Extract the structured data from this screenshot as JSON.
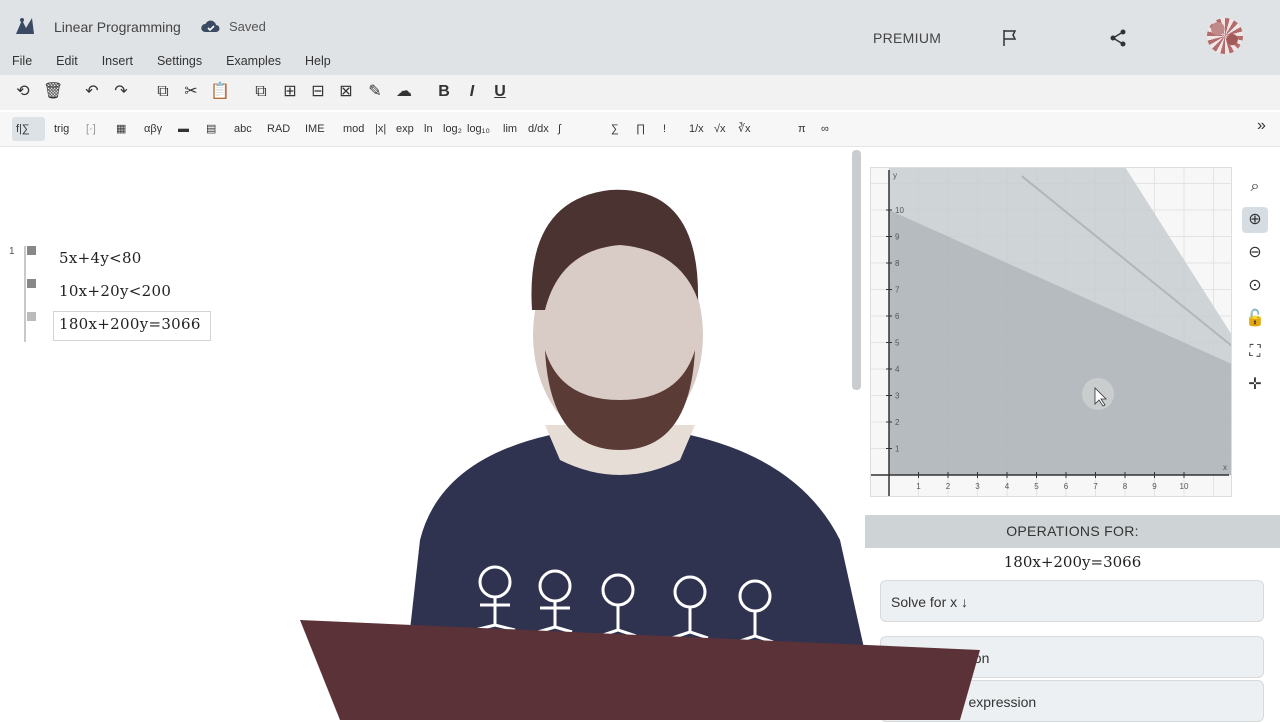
{
  "app": {
    "title": "Linear Programming",
    "saved_status": "Saved",
    "premium_label": "PREMIUM"
  },
  "menu": [
    "File",
    "Edit",
    "Insert",
    "Settings",
    "Examples",
    "Help"
  ],
  "toolbar2": {
    "items": [
      "f|∑",
      "trig",
      "[·]",
      "αβγ",
      "abc",
      "RAD",
      "IME",
      "mod",
      "|x|",
      "exp",
      "ln",
      "log₂",
      "log₁₀",
      "lim",
      "d/dx",
      "∫",
      "∑",
      "∏",
      "!",
      "1/x",
      "√x",
      "∛x",
      "π",
      "∞"
    ]
  },
  "editor": {
    "line_number": "1",
    "equations": [
      "5x+4y<80",
      "10x+20y<200",
      "180x+200y=3066"
    ]
  },
  "graph": {
    "x_ticks": [
      "1",
      "2",
      "3",
      "4",
      "5",
      "6",
      "7",
      "8",
      "9",
      "10"
    ],
    "y_ticks": [
      "1",
      "2",
      "3",
      "4",
      "5",
      "6",
      "7",
      "8",
      "9",
      "10"
    ],
    "x_axis_label": "x",
    "y_axis_label": "y"
  },
  "operations": {
    "header": "OPERATIONS FOR:",
    "expression": "180x+200y=3066",
    "solve_label": "Solve for x ↓",
    "op2_label": "ation",
    "op3_label": "he expression"
  },
  "icons": {
    "logo": "geogebra-like-logo-icon",
    "saved": "cloud-check-icon",
    "flag": "flag-icon",
    "share": "share-icon"
  },
  "colors": {
    "region_dark": "#a9b1b5",
    "region_light": "#c8ced1",
    "accent": "#333333"
  }
}
